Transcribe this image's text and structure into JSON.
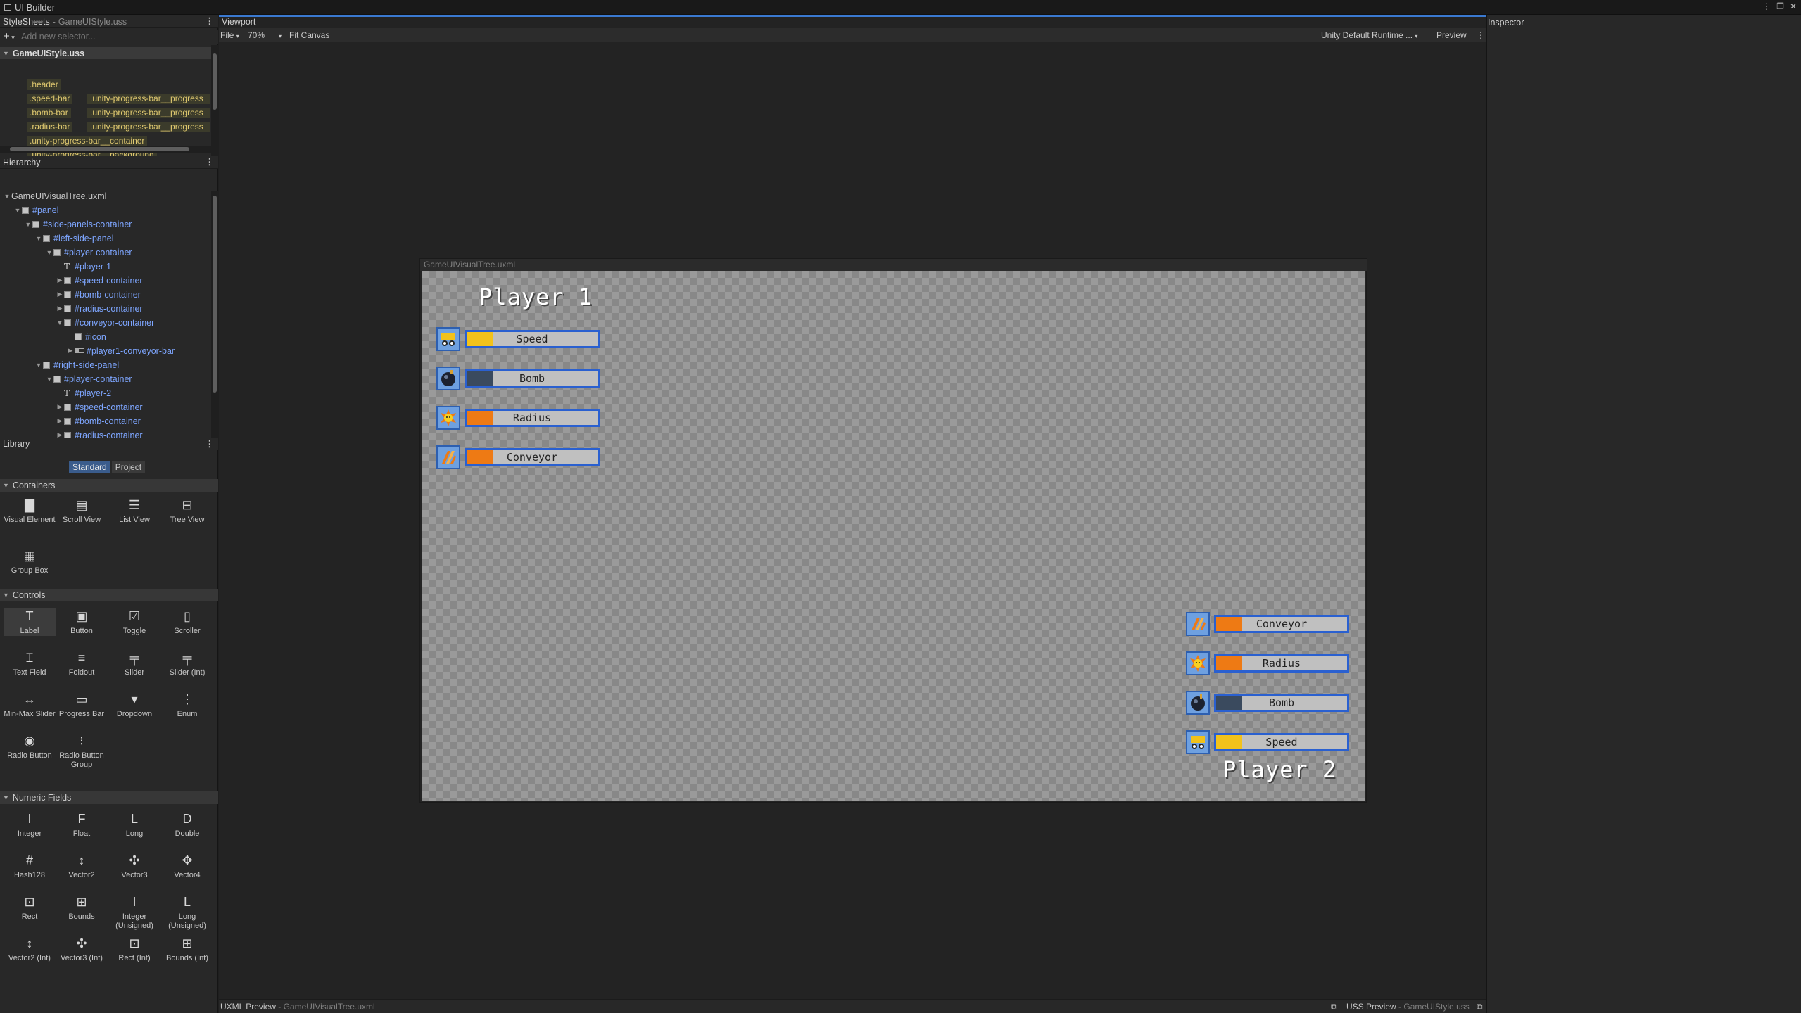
{
  "window": {
    "title": "UI Builder"
  },
  "stylesheets": {
    "header": "StyleSheets",
    "file_name": "GameUIStyle.uss",
    "add_selector_placeholder": "Add new selector...",
    "file_row": "GameUIStyle.uss",
    "selectors_left": [
      ".header",
      ".speed-bar",
      ".bomb-bar",
      ".radius-bar",
      ".unity-progress-bar__container",
      ".unity-progress-bar__background"
    ],
    "selectors_right": [
      ".unity-progress-bar__progress",
      ".unity-progress-bar__progress",
      ".unity-progress-bar__progress"
    ]
  },
  "hierarchy": {
    "header": "Hierarchy",
    "rows": [
      {
        "label": "GameUIVisualTree.uxml",
        "kind": "root"
      },
      {
        "label": "#panel",
        "kind": "ve"
      },
      {
        "label": "#side-panels-container",
        "kind": "ve"
      },
      {
        "label": "#left-side-panel",
        "kind": "ve"
      },
      {
        "label": "#player-container",
        "kind": "ve"
      },
      {
        "label": "#player-1",
        "kind": "label"
      },
      {
        "label": "#speed-container",
        "kind": "ve"
      },
      {
        "label": "#bomb-container",
        "kind": "ve"
      },
      {
        "label": "#radius-container",
        "kind": "ve"
      },
      {
        "label": "#conveyor-container",
        "kind": "ve"
      },
      {
        "label": "#icon",
        "kind": "ve"
      },
      {
        "label": "#player1-conveyor-bar",
        "kind": "progress"
      },
      {
        "label": "#right-side-panel",
        "kind": "ve"
      },
      {
        "label": "#player-container",
        "kind": "ve"
      },
      {
        "label": "#player-2",
        "kind": "label"
      },
      {
        "label": "#speed-container",
        "kind": "ve"
      },
      {
        "label": "#bomb-container",
        "kind": "ve"
      },
      {
        "label": "#radius-container",
        "kind": "ve"
      }
    ]
  },
  "library": {
    "header": "Library",
    "tabs": [
      "Standard",
      "Project"
    ],
    "categories": {
      "containers": "Containers",
      "controls": "Controls",
      "numeric": "Numeric Fields"
    },
    "containers": [
      "Visual Element",
      "Scroll View",
      "List View",
      "Tree View",
      "Group Box"
    ],
    "controls": [
      "Label",
      "Button",
      "Toggle",
      "Scroller",
      "Text Field",
      "Foldout",
      "Slider",
      "Slider (Int)",
      "Min-Max Slider",
      "Progress Bar",
      "Dropdown",
      "Enum",
      "Radio Button",
      "Radio Button Group"
    ],
    "numeric": [
      "Integer",
      "Float",
      "Long",
      "Double",
      "Hash128",
      "Vector2",
      "Vector3",
      "Vector4",
      "Rect",
      "Bounds",
      "Integer (Unsigned)",
      "Long (Unsigned)",
      "Vector2 (Int)",
      "Vector3 (Int)",
      "Rect (Int)",
      "Bounds (Int)"
    ]
  },
  "viewport": {
    "header": "Viewport",
    "file_menu": "File",
    "zoom": "70%",
    "fit_canvas": "Fit Canvas",
    "theme": "Unity Default Runtime ...",
    "preview": "Preview",
    "canvas_title": "GameUIVisualTree.uxml",
    "footer_uxml_label": "UXML Preview",
    "footer_uxml_file": "GameUIVisualTree.uxml",
    "footer_uss_label": "USS Preview",
    "footer_uss_file": "GameUIStyle.uss"
  },
  "game": {
    "player1": {
      "title": "Player 1",
      "stats": [
        {
          "label": "Speed",
          "fill": 0.2,
          "color": "#f2c21b",
          "icon": "speed-icon"
        },
        {
          "label": "Bomb",
          "fill": 0.2,
          "color": "#3a4a5e",
          "icon": "bomb-icon"
        },
        {
          "label": "Radius",
          "fill": 0.2,
          "color": "#ee7a14",
          "icon": "radius-icon"
        },
        {
          "label": "Conveyor",
          "fill": 0.2,
          "color": "#ee7a14",
          "icon": "conveyor-icon"
        }
      ]
    },
    "player2": {
      "title": "Player 2",
      "stats": [
        {
          "label": "Conveyor",
          "fill": 0.2,
          "color": "#ee7a14",
          "icon": "conveyor-icon"
        },
        {
          "label": "Radius",
          "fill": 0.2,
          "color": "#ee7a14",
          "icon": "radius-icon"
        },
        {
          "label": "Bomb",
          "fill": 0.2,
          "color": "#3a4a5e",
          "icon": "bomb-icon"
        },
        {
          "label": "Speed",
          "fill": 0.2,
          "color": "#f2c21b",
          "icon": "speed-icon"
        }
      ]
    }
  },
  "inspector": {
    "header": "Inspector"
  }
}
